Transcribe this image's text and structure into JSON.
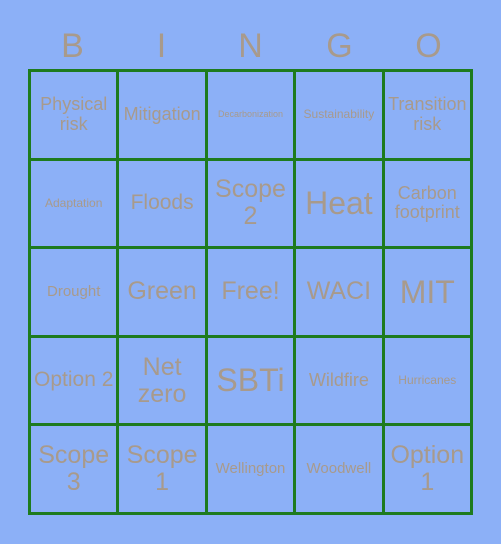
{
  "card": {
    "title": "BINGO",
    "background_color": "#8cb0f7",
    "border_color": "#1e7b1e",
    "text_color": "#a89a8c",
    "columns": 5,
    "rows": 5
  },
  "header": {
    "letters": [
      "B",
      "I",
      "N",
      "G",
      "O"
    ]
  },
  "grid": {
    "cells": [
      {
        "label": "Physical risk",
        "size": "fs-m"
      },
      {
        "label": "Mitigation",
        "size": "fs-m"
      },
      {
        "label": "Decarbonization",
        "size": "fs-xxs"
      },
      {
        "label": "Sustainability",
        "size": "fs-xs"
      },
      {
        "label": "Transition risk",
        "size": "fs-m"
      },
      {
        "label": "Adaptation",
        "size": "fs-xs"
      },
      {
        "label": "Floods",
        "size": "fs-l"
      },
      {
        "label": "Scope 2",
        "size": "fs-xl"
      },
      {
        "label": "Heat",
        "size": "fs-xxl"
      },
      {
        "label": "Carbon footprint",
        "size": "fs-m"
      },
      {
        "label": "Drought",
        "size": "fs-s"
      },
      {
        "label": "Green",
        "size": "fs-xl"
      },
      {
        "label": "Free!",
        "size": "fs-xl"
      },
      {
        "label": "WACI",
        "size": "fs-xl"
      },
      {
        "label": "MIT",
        "size": "fs-xxl"
      },
      {
        "label": "Option 2",
        "size": "fs-l"
      },
      {
        "label": "Net zero",
        "size": "fs-xl"
      },
      {
        "label": "SBTi",
        "size": "fs-xxl"
      },
      {
        "label": "Wildfire",
        "size": "fs-m"
      },
      {
        "label": "Hurricanes",
        "size": "fs-xs"
      },
      {
        "label": "Scope 3",
        "size": "fs-xl"
      },
      {
        "label": "Scope 1",
        "size": "fs-xl"
      },
      {
        "label": "Wellington",
        "size": "fs-s"
      },
      {
        "label": "Woodwell",
        "size": "fs-s"
      },
      {
        "label": "Option 1",
        "size": "fs-xl"
      }
    ]
  }
}
